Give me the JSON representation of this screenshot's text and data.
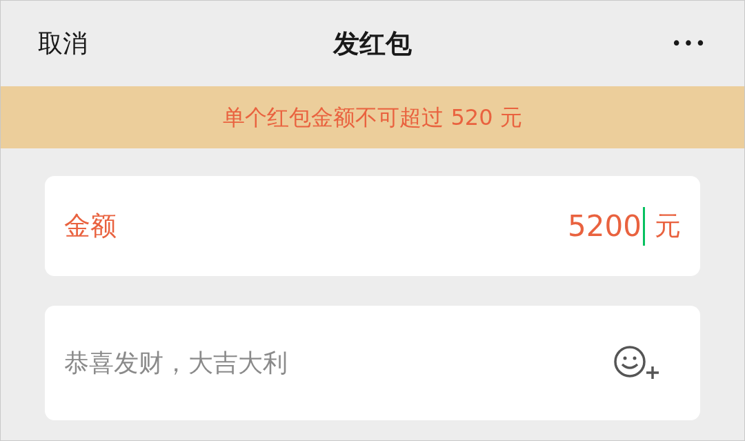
{
  "nav_bar": {
    "cancel": "取消",
    "title": "发红包",
    "more": "•••"
  },
  "notice": "单个红包金额不可超过 520 元",
  "amount": {
    "label": "金额",
    "value": "5200",
    "unit": "元",
    "focused": true
  },
  "message": {
    "placeholder": "恭喜发财，大吉大利"
  }
}
